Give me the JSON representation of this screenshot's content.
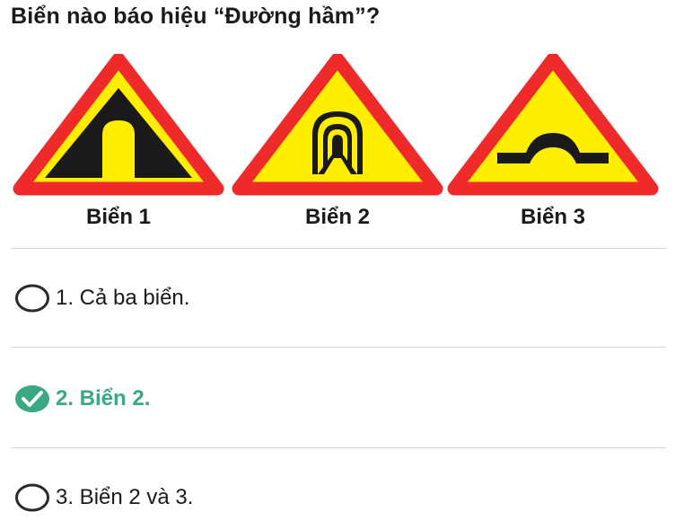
{
  "question": {
    "text": "Biển nào báo hiệu “Đường hầm”?"
  },
  "signs": [
    {
      "label": "Biển 1",
      "icon": "tunnel-road-icon"
    },
    {
      "label": "Biển 2",
      "icon": "tunnel-entrance-icon"
    },
    {
      "label": "Biển 3",
      "icon": "hump-bridge-icon"
    }
  ],
  "options": [
    {
      "text": "1. Cả ba biển.",
      "selected": false,
      "icon": "radio-empty-icon"
    },
    {
      "text": "2. Biển 2.",
      "selected": true,
      "icon": "check-circle-icon"
    },
    {
      "text": "3. Biển 2 và 3.",
      "selected": false,
      "icon": "radio-empty-icon"
    }
  ],
  "colors": {
    "sign_border": "#ee2a2a",
    "sign_fill": "#ffee00",
    "sign_symbol": "#1a1a1a",
    "correct": "#3aa881",
    "divider": "#d6d6d6"
  }
}
